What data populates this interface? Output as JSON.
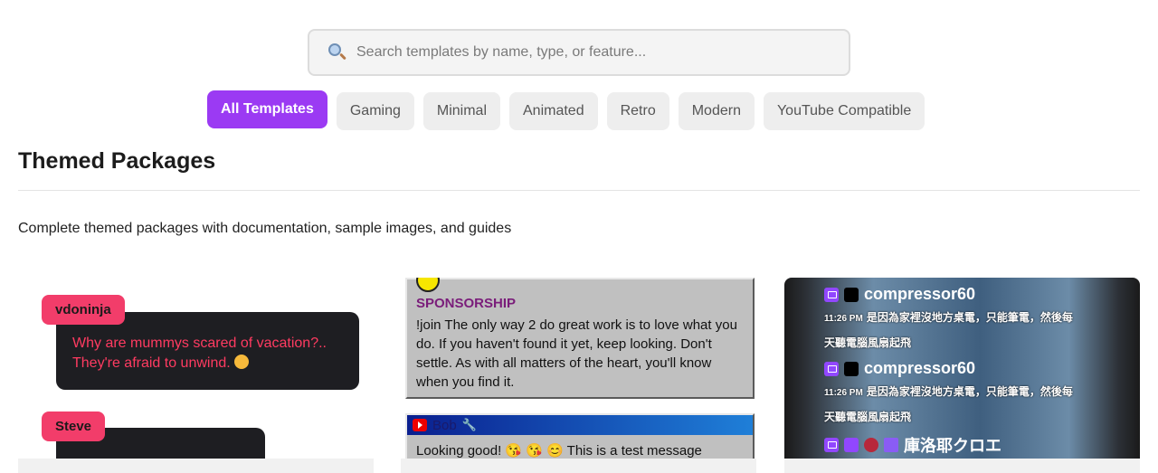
{
  "search": {
    "placeholder": "Search templates by name, type, or feature...",
    "icon": "search-icon"
  },
  "filters": [
    {
      "label": "All Templates",
      "active": true
    },
    {
      "label": "Gaming",
      "active": false
    },
    {
      "label": "Minimal",
      "active": false
    },
    {
      "label": "Animated",
      "active": false
    },
    {
      "label": "Retro",
      "active": false
    },
    {
      "label": "Modern",
      "active": false
    },
    {
      "label": "YouTube Compatible",
      "active": false
    }
  ],
  "section": {
    "title": "Themed Packages",
    "description": "Complete themed packages with documentation, sample images, and guides"
  },
  "cards": {
    "card1": {
      "msg1_user": "vdoninja",
      "msg1_text": "Why are mummys scared of vacation?.. They're afraid to unwind.",
      "msg2_user": "Steve"
    },
    "card2": {
      "sponsor_label": "SPONSORSHIP",
      "sponsor_text": "!join The only way 2 do great work is to love what you do. If you haven't found it yet, keep looking. Don't settle. As with all matters of the heart, you'll know when you find it.",
      "msg2_user": "Bob",
      "msg2_text": "Looking good! 😘 😘 😊 This is a test message"
    },
    "card3": {
      "msg1_user": "compressor60",
      "msg1_time": "11:26 PM",
      "msg1_text": "是因為家裡沒地方桌電，只能筆電，然後每",
      "msg1_text2": "天聽電腦風扇起飛",
      "msg2_user": "compressor60",
      "msg2_time": "11:26 PM",
      "msg2_text": "是因為家裡沒地方桌電，只能筆電，然後每",
      "msg2_text2": "天聽電腦風扇起飛",
      "msg3_user": "庫洛耶クロエ"
    }
  },
  "colors": {
    "accent": "#9b3af3",
    "chip_bg": "#eeeeee",
    "bubble_name": "#f23d6a"
  }
}
